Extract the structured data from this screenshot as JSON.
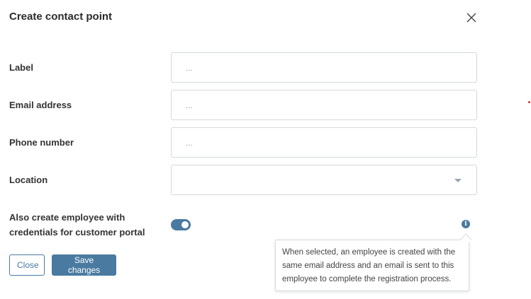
{
  "dialog": {
    "title": "Create contact point",
    "close_icon": "close-icon"
  },
  "form": {
    "label": {
      "label": "Label",
      "placeholder": "...",
      "value": ""
    },
    "email": {
      "label": "Email address",
      "placeholder": "...",
      "value": ""
    },
    "phone": {
      "label": "Phone number",
      "placeholder": "...",
      "value": ""
    },
    "location": {
      "label": "Location",
      "value": "",
      "caret_icon": "chevron-down-icon"
    },
    "employee": {
      "label_line1": "Also create employee with",
      "label_line2": "credentials for customer portal",
      "toggle_on": true,
      "info_icon": "info-icon",
      "info_glyph": "i"
    }
  },
  "tooltip": {
    "line1": "When selected, an employee is created with the",
    "line2": "same email address and an email is sent to this",
    "line3": "employee to complete the registration process."
  },
  "buttons": {
    "close_label": "Close",
    "save_label": "Save changes"
  },
  "colors": {
    "accent": "#4a7aa0",
    "border": "#d4d9de",
    "text": "#333333"
  }
}
